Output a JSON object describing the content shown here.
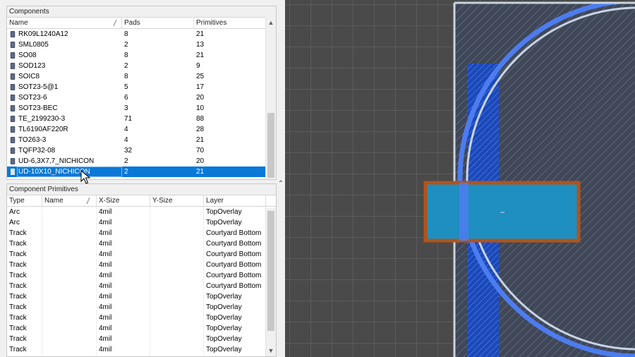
{
  "components_panel": {
    "title": "Components",
    "columns": [
      "Name",
      "Pads",
      "Primitives"
    ],
    "rows": [
      {
        "name": "RK09L1240A12",
        "pads": "8",
        "primitives": "21"
      },
      {
        "name": "SML0805",
        "pads": "2",
        "primitives": "13"
      },
      {
        "name": "SO08",
        "pads": "8",
        "primitives": "21"
      },
      {
        "name": "SOD123",
        "pads": "2",
        "primitives": "9"
      },
      {
        "name": "SOIC8",
        "pads": "8",
        "primitives": "25"
      },
      {
        "name": "SOT23-5@1",
        "pads": "5",
        "primitives": "17"
      },
      {
        "name": "SOT23-6",
        "pads": "6",
        "primitives": "20"
      },
      {
        "name": "SOT23-BEC",
        "pads": "3",
        "primitives": "10"
      },
      {
        "name": "TE_2199230-3",
        "pads": "71",
        "primitives": "88"
      },
      {
        "name": "TL6190AF220R",
        "pads": "4",
        "primitives": "28"
      },
      {
        "name": "TO263-3",
        "pads": "4",
        "primitives": "21"
      },
      {
        "name": "TQFP32-08",
        "pads": "32",
        "primitives": "70"
      },
      {
        "name": "UD-6,3X7,7_NICHICON",
        "pads": "2",
        "primitives": "20"
      },
      {
        "name": "UD-10X10_NICHICON",
        "pads": "2",
        "primitives": "21",
        "selected": true
      }
    ]
  },
  "primitives_panel": {
    "title": "Component Primitives",
    "columns": [
      "Type",
      "Name",
      "X-Size",
      "Y-Size",
      "Layer"
    ],
    "rows": [
      {
        "type": "Arc",
        "name": "",
        "xsize": "4mil",
        "ysize": "",
        "layer": "TopOverlay"
      },
      {
        "type": "Arc",
        "name": "",
        "xsize": "4mil",
        "ysize": "",
        "layer": "TopOverlay"
      },
      {
        "type": "Track",
        "name": "",
        "xsize": "4mil",
        "ysize": "",
        "layer": "Courtyard Bottom"
      },
      {
        "type": "Track",
        "name": "",
        "xsize": "4mil",
        "ysize": "",
        "layer": "Courtyard Bottom"
      },
      {
        "type": "Track",
        "name": "",
        "xsize": "4mil",
        "ysize": "",
        "layer": "Courtyard Bottom"
      },
      {
        "type": "Track",
        "name": "",
        "xsize": "4mil",
        "ysize": "",
        "layer": "Courtyard Bottom"
      },
      {
        "type": "Track",
        "name": "",
        "xsize": "4mil",
        "ysize": "",
        "layer": "Courtyard Bottom"
      },
      {
        "type": "Track",
        "name": "",
        "xsize": "4mil",
        "ysize": "",
        "layer": "Courtyard Bottom"
      },
      {
        "type": "Track",
        "name": "",
        "xsize": "4mil",
        "ysize": "",
        "layer": "TopOverlay"
      },
      {
        "type": "Track",
        "name": "",
        "xsize": "4mil",
        "ysize": "",
        "layer": "TopOverlay"
      },
      {
        "type": "Track",
        "name": "",
        "xsize": "4mil",
        "ysize": "",
        "layer": "TopOverlay"
      },
      {
        "type": "Track",
        "name": "",
        "xsize": "4mil",
        "ysize": "",
        "layer": "TopOverlay"
      },
      {
        "type": "Track",
        "name": "",
        "xsize": "4mil",
        "ysize": "",
        "layer": "TopOverlay"
      },
      {
        "type": "Track",
        "name": "",
        "xsize": "4mil",
        "ysize": "",
        "layer": "TopOverlay"
      }
    ]
  },
  "canvas": {
    "pad_label": "uss",
    "colors": {
      "background": "#4a4a4a",
      "grid": "#6a6a6a",
      "board_outline": "#c8d4dc",
      "overlay_arc": "#4d7cf0",
      "pad_fill": "#1e8fc0",
      "pad_border": "#b3531a",
      "selection": "#0a78d7"
    }
  }
}
